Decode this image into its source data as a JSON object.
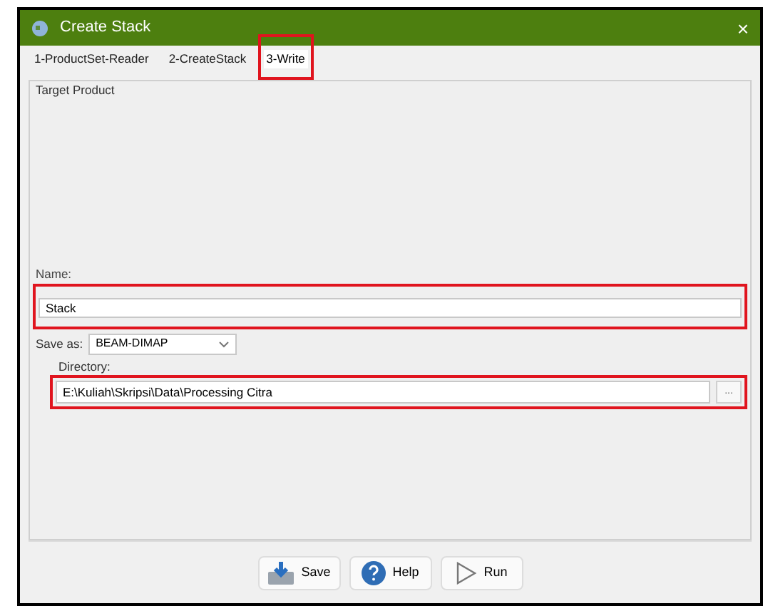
{
  "window": {
    "title": "Create Stack",
    "close": "×"
  },
  "tabs": [
    {
      "label": "1-ProductSet-Reader",
      "selected": false
    },
    {
      "label": "2-CreateStack",
      "selected": false
    },
    {
      "label": "3-Write",
      "selected": true
    }
  ],
  "group": {
    "title": "Target Product"
  },
  "name_field": {
    "label": "Name:",
    "value": "Stack",
    "highlighted": true
  },
  "save_as": {
    "label": "Save as:",
    "value": "BEAM-DIMAP"
  },
  "directory_field": {
    "label": "Directory:",
    "value": "E:\\Kuliah\\Skripsi\\Data\\Processing Citra",
    "browse": "...",
    "highlighted": true
  },
  "buttons": [
    {
      "kind": "save",
      "label": "Save"
    },
    {
      "kind": "help",
      "label": "Help"
    },
    {
      "kind": "run",
      "label": "Run"
    }
  ]
}
